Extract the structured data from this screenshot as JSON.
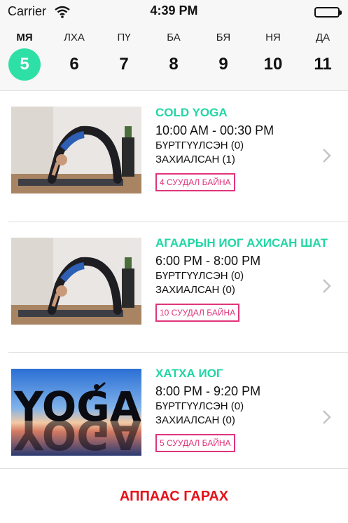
{
  "status_bar": {
    "carrier": "Carrier",
    "time": "4:39 PM"
  },
  "calendar": {
    "days": [
      {
        "dow": "МЯ",
        "num": "5",
        "selected": true
      },
      {
        "dow": "ЛХА",
        "num": "6"
      },
      {
        "dow": "ПҮ",
        "num": "7"
      },
      {
        "dow": "БА",
        "num": "8"
      },
      {
        "dow": "БЯ",
        "num": "9"
      },
      {
        "dow": "НЯ",
        "num": "10"
      },
      {
        "dow": "ДА",
        "num": "11"
      }
    ]
  },
  "classes": [
    {
      "title": "COLD YOGA",
      "time": "10:00 AM - 00:30 PM",
      "registered": "БҮРТГҮҮЛСЭН (0)",
      "booked": "ЗАХИАЛСАН (1)",
      "seats_badge": "4 СУУДАЛ БАЙНА",
      "image": "yoga-wheel-pose-photo"
    },
    {
      "title": "АГААРЫН ИОГ АХИСАН ШАТ",
      "time": "6:00 PM - 8:00 PM",
      "registered": "БҮРТГҮҮЛСЭН (0)",
      "booked": "ЗАХИАЛСАН (0)",
      "seats_badge": "10 СУУДАЛ БАЙНА",
      "image": "yoga-wheel-pose-photo"
    },
    {
      "title": "ХАТХА ИОГ",
      "time": "8:00 PM - 9:20 PM",
      "registered": "БҮРТГҮҮЛСЭН (0)",
      "booked": "ЗАХИАЛСАН (0)",
      "seats_badge": "5 СУУДАЛ БАЙНА",
      "image": "yoga-sunset-silhouette-photo"
    }
  ],
  "footer": {
    "logout_label": "АППААС ГАРАХ"
  },
  "colors": {
    "accent_green": "#2ee0a5",
    "title_green": "#22d6a4",
    "badge_pink": "#e0357b",
    "logout_red": "#e6121a"
  }
}
